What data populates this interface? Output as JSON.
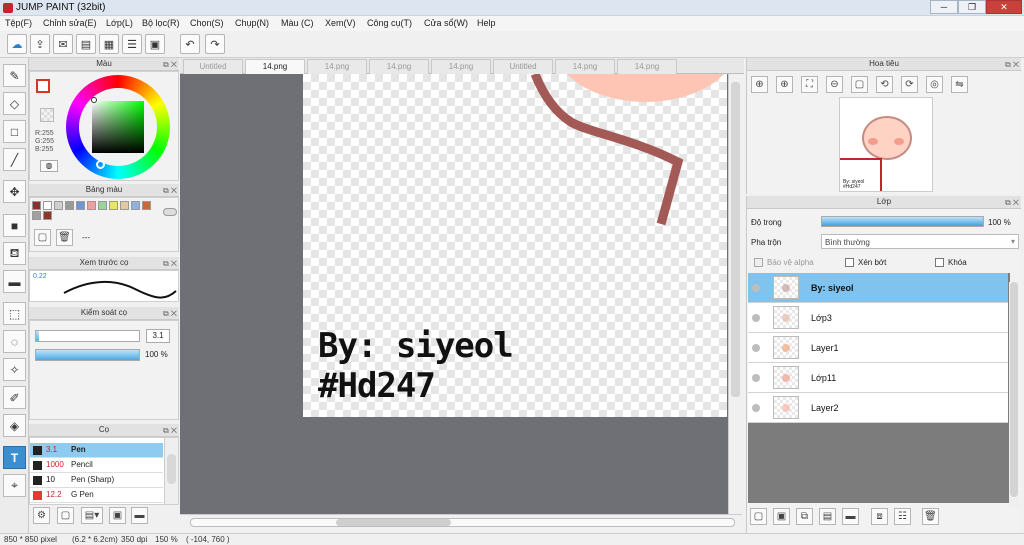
{
  "window": {
    "title": "JUMP PAINT (32bit)",
    "minimize": "─",
    "maximize": "❐",
    "close": "✕"
  },
  "menu": [
    "Tệp(F)",
    "Chỉnh sửa(E)",
    "Lớp(L)",
    "Bộ lọc(R)",
    "Chọn(S)",
    "Chụp(N)",
    "Màu (C)",
    "Xem(V)",
    "Công cụ(T)",
    "Cửa sổ(W)",
    "Help"
  ],
  "color_panel": {
    "title": "Màu",
    "r": "R:255",
    "g": "G:255",
    "b": "B:255",
    "foreground": "#ffffff",
    "hue": "#00ff00"
  },
  "palette_panel": {
    "title": "Bảng màu",
    "dash": "---",
    "swatches": [
      "#8b2f2f",
      "#ffffff",
      "#cfcfcf",
      "#9a9a9a",
      "#6f95d4",
      "#f0a0a0",
      "#9ad49a",
      "#e8e860",
      "#e6c8a0",
      "#8fb0e0",
      "#c86a3a",
      "#a0a0a0",
      "#8b3a2a"
    ]
  },
  "brush_preview": {
    "title": "Xem trước cọ",
    "size": "0.22"
  },
  "brush_control": {
    "title": "Kiểm soát cọ",
    "size": "3.1",
    "opacity": "100 %"
  },
  "brush_list": {
    "title": "Cọ",
    "items": [
      {
        "size": "3.1",
        "name": "Pen",
        "selected": true
      },
      {
        "size": "1000",
        "name": "Pencil",
        "selected": false
      },
      {
        "size": "10",
        "name": "Pen (Sharp)",
        "selected": false
      },
      {
        "size": "12.2",
        "name": "G Pen",
        "selected": false
      }
    ]
  },
  "tabs": [
    {
      "label": "Untitled",
      "active": false
    },
    {
      "label": "14.png",
      "active": true
    },
    {
      "label": "14.png",
      "active": false
    },
    {
      "label": "14.png",
      "active": false
    },
    {
      "label": "14.png",
      "active": false
    },
    {
      "label": "Untitled",
      "active": false
    },
    {
      "label": "14.png",
      "active": false
    },
    {
      "label": "14.png",
      "active": false
    }
  ],
  "canvas": {
    "line1": "By: siyeol",
    "line2": "#Hd247"
  },
  "navigator": {
    "title": "Hoa tiêu",
    "preview_text": "By: siyeol #Hd247"
  },
  "layer_panel": {
    "title": "Lớp",
    "opacity_label": "Độ trong",
    "opacity_value": "100 %",
    "blend_label": "Pha trộn",
    "blend_value": "Bình thường",
    "protect_alpha": "Bảo vệ alpha",
    "clip": "Xén bớt",
    "lock": "Khóa",
    "layers": [
      {
        "name": "By: siyeol",
        "active": true
      },
      {
        "name": "Lớp3",
        "active": false
      },
      {
        "name": "Layer1",
        "active": false
      },
      {
        "name": "Lớp11",
        "active": false
      },
      {
        "name": "Layer2",
        "active": false
      }
    ]
  },
  "status": {
    "dimensions": "850 * 850 pixel",
    "size_cm": "(6.2 * 6.2cm)",
    "dpi": "350 dpi",
    "zoom": "150 %",
    "coords": "( -104, 760 )"
  }
}
